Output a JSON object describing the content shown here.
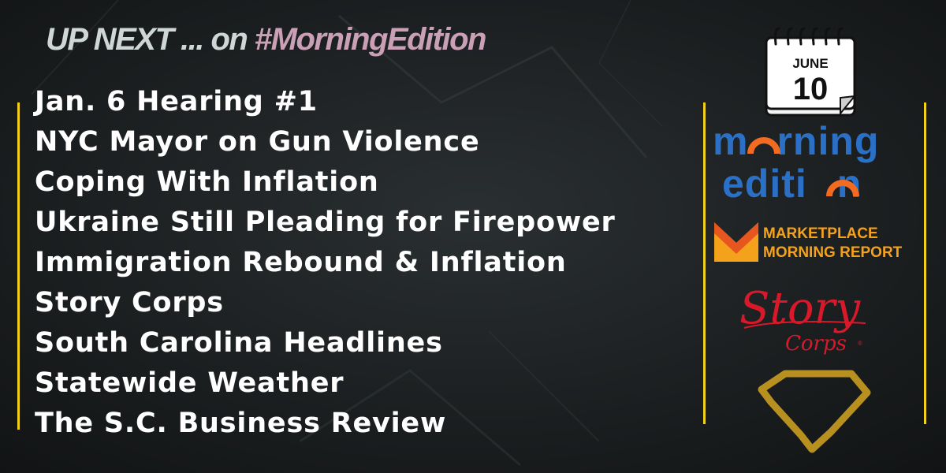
{
  "header": {
    "prefix": "UP NEXT ... on ",
    "hashtag": "#MorningEdition"
  },
  "lineup": [
    "Jan. 6 Hearing #1",
    "NYC Mayor on Gun Violence",
    "Coping With Inflation",
    "Ukraine Still Pleading for Firepower",
    "Immigration Rebound & Inflation",
    "Story Corps",
    "South Carolina Headlines",
    "Statewide Weather",
    "The S.C. Business Review"
  ],
  "calendar": {
    "month": "JUNE",
    "day": "10"
  },
  "logos": {
    "morning_edition": {
      "line1_a": "m",
      "line1_b": "rning",
      "line2_a": "editi",
      "line2_b": "n"
    },
    "marketplace": {
      "line1": "MARKETPLACE",
      "line2": "MORNING REPORT"
    },
    "storycorps": {
      "story": "Story",
      "corps": "Corps"
    }
  },
  "colors": {
    "accent_yellow": "#f2d11c",
    "hashtag_pink": "#c9a0b6",
    "npr_blue": "#2a70c7",
    "npr_orange": "#f26b21",
    "marketplace_orange": "#f4a21c",
    "storycorps_red": "#d9192a",
    "sc_gold": "#b8901f"
  },
  "icons": [
    "calendar-icon",
    "south-carolina-outline-icon"
  ]
}
